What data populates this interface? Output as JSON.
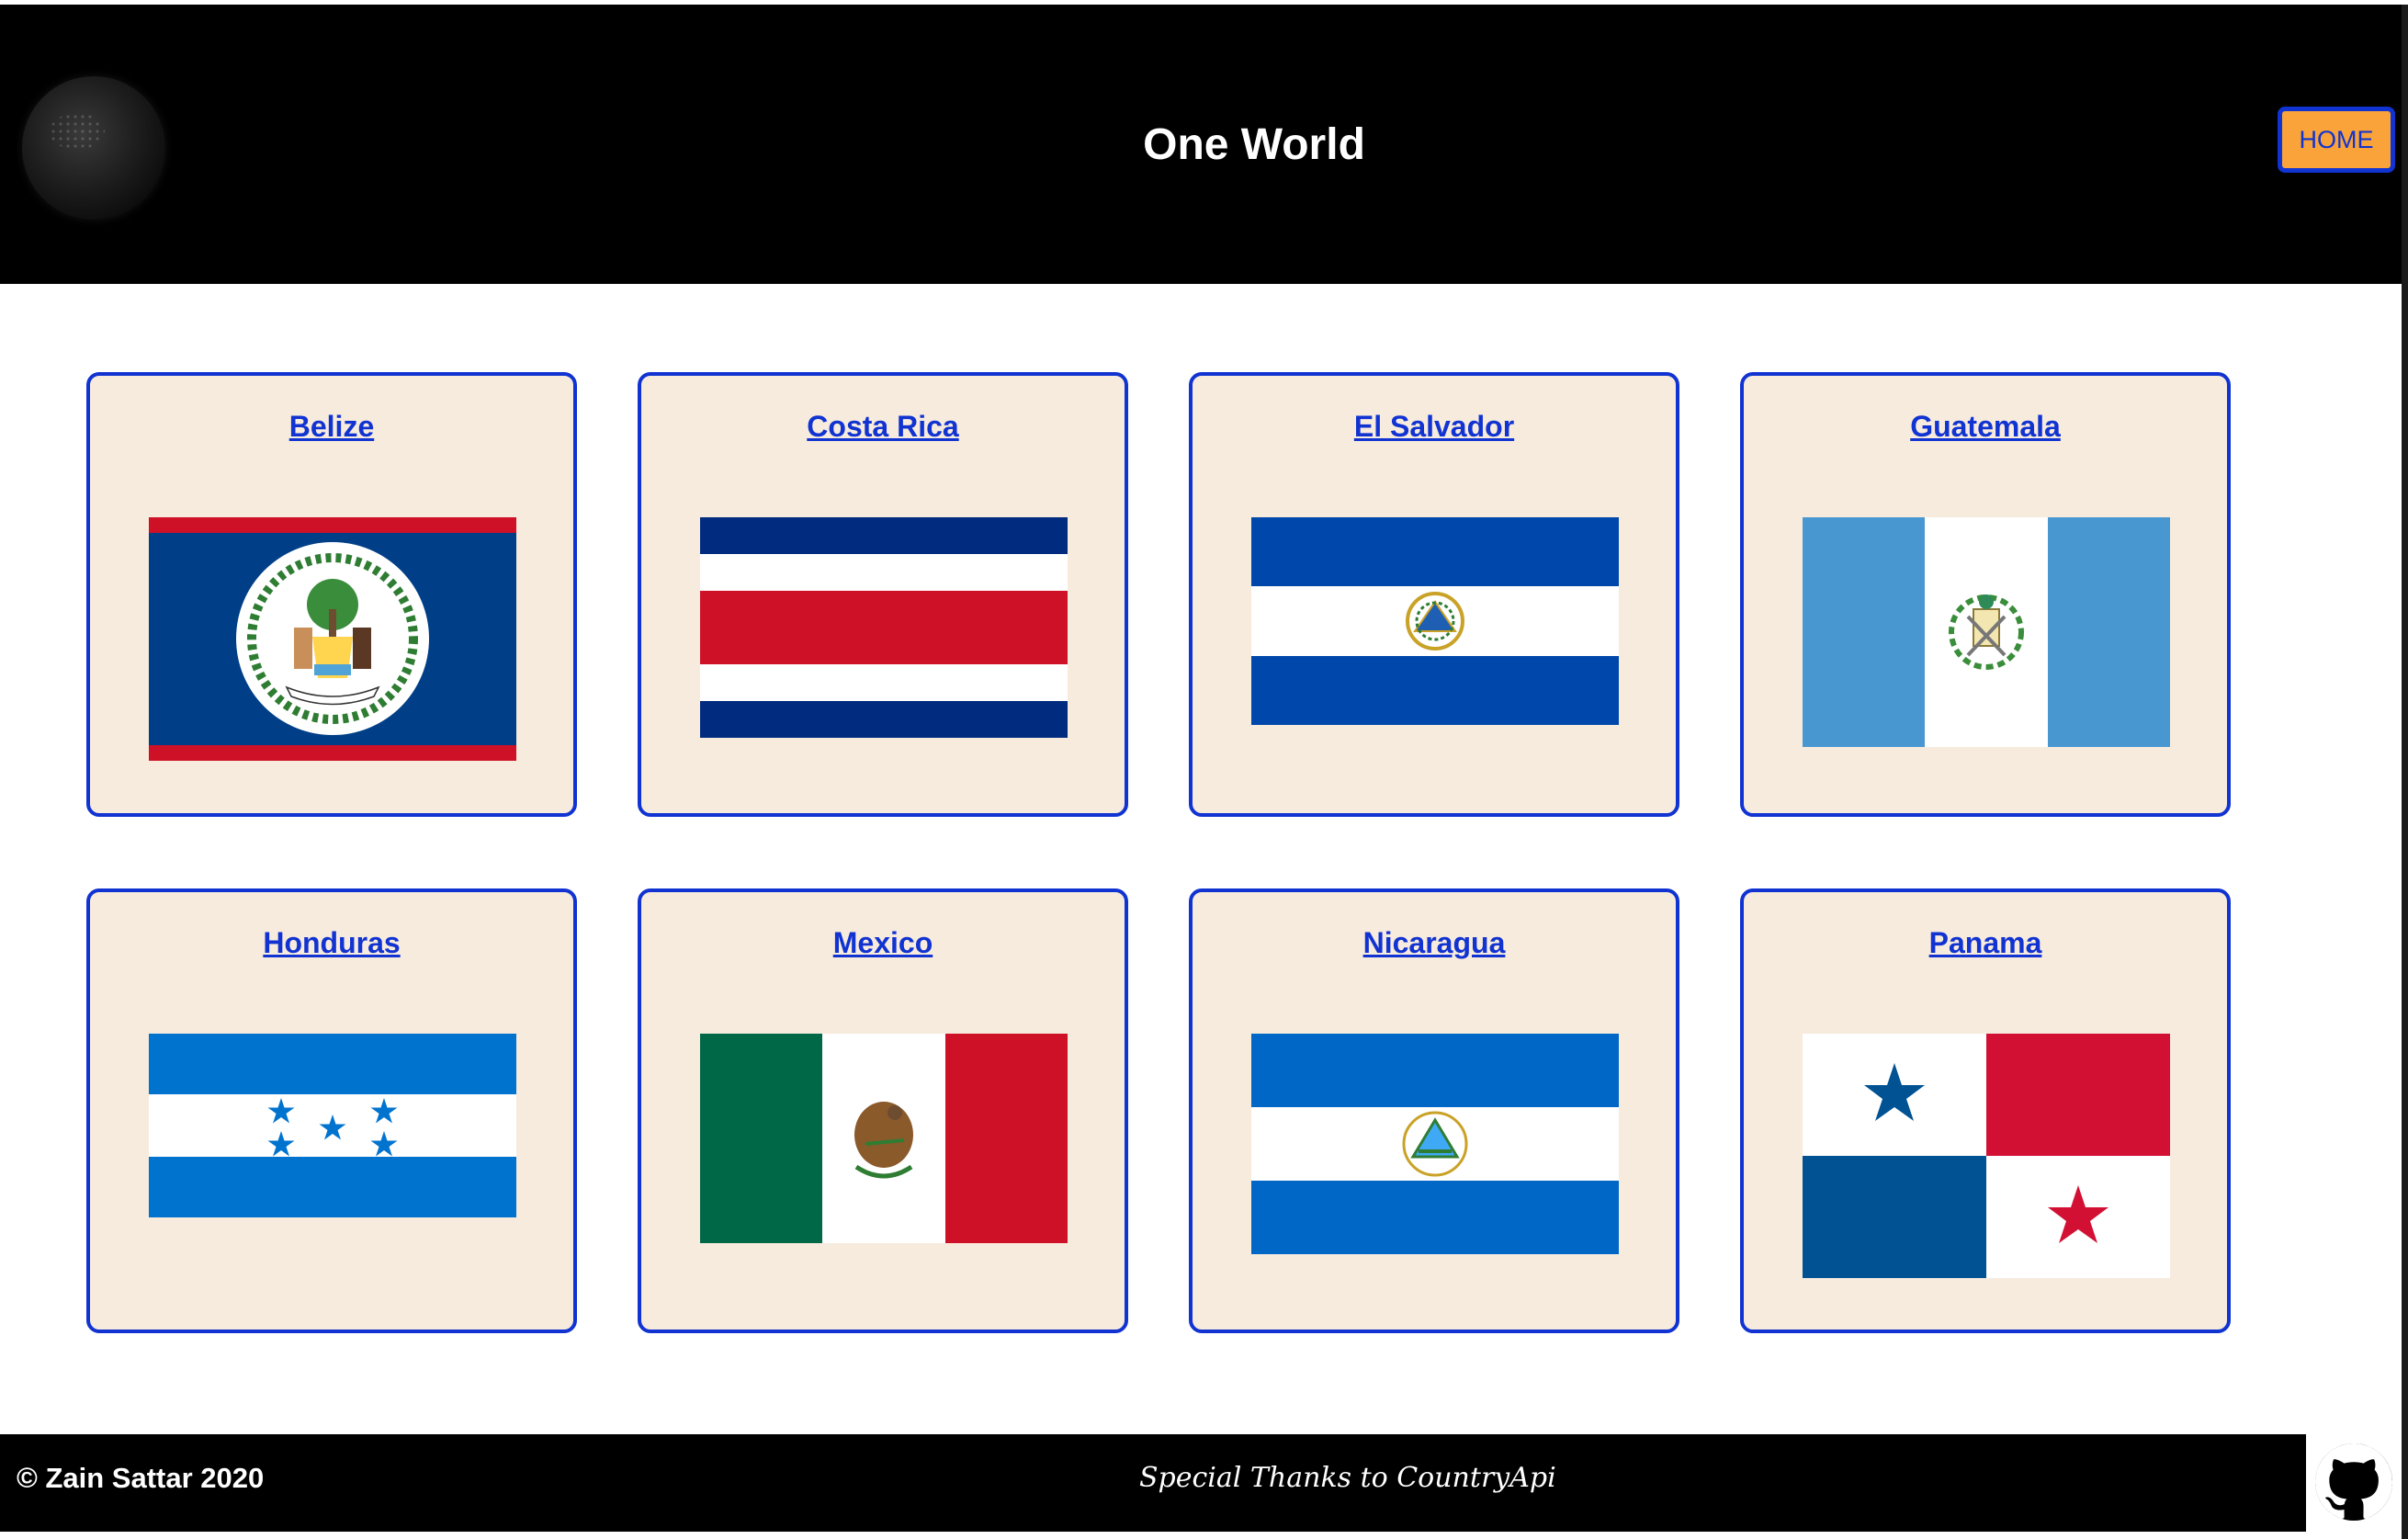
{
  "header": {
    "title": "One World",
    "home_label": "HOME"
  },
  "countries": [
    {
      "name": "Belize"
    },
    {
      "name": "Costa Rica"
    },
    {
      "name": "El Salvador"
    },
    {
      "name": "Guatemala"
    },
    {
      "name": "Honduras"
    },
    {
      "name": "Mexico"
    },
    {
      "name": "Nicaragua"
    },
    {
      "name": "Panama"
    }
  ],
  "footer": {
    "copyright": "© Zain Sattar 2020",
    "thanks": "Special Thanks to CountryApi"
  },
  "colors": {
    "accent_blue": "#1033d1",
    "home_button": "#f9a33a",
    "card_background": "#f7ebde"
  },
  "icons": [
    "globe-icon",
    "github-icon"
  ]
}
